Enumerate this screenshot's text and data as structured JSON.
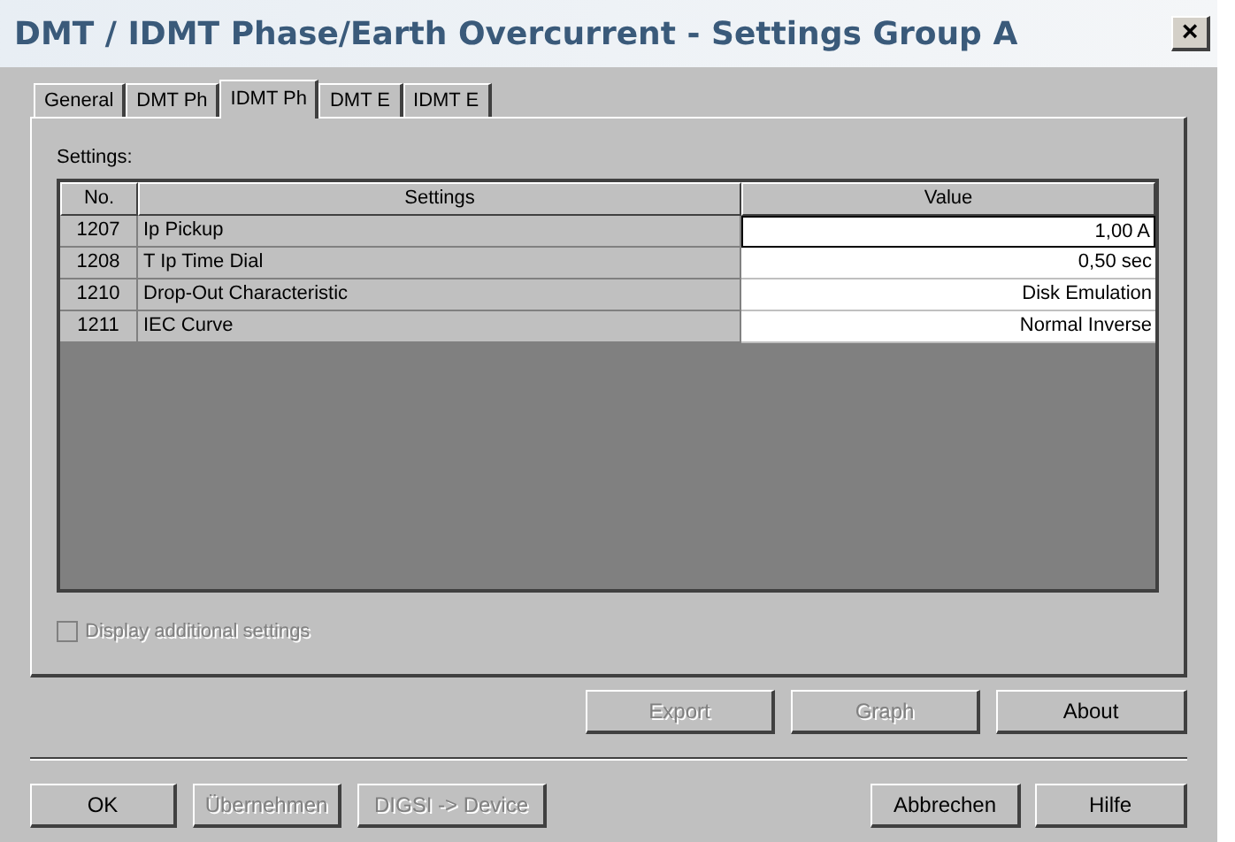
{
  "window": {
    "title": "DMT / IDMT Phase/Earth Overcurrent - Settings Group A",
    "close": "×"
  },
  "tabs": [
    {
      "label": "General",
      "selected": false
    },
    {
      "label": "DMT Ph",
      "selected": false
    },
    {
      "label": "IDMT Ph",
      "selected": true
    },
    {
      "label": "DMT E",
      "selected": false
    },
    {
      "label": "IDMT E",
      "selected": false
    }
  ],
  "settings_label": {
    "text": "Settings:"
  },
  "table": {
    "columns": [
      "No.",
      "Settings",
      "Value"
    ],
    "rows": [
      {
        "no": "1207",
        "setting": "Ip Pickup",
        "value": "1,00 A",
        "selected": true
      },
      {
        "no": "1208",
        "setting": "T Ip Time Dial",
        "value": "0,50 sec",
        "selected": false
      },
      {
        "no": "1210",
        "setting": "Drop-Out Characteristic",
        "value": "Disk Emulation",
        "selected": false
      },
      {
        "no": "1211",
        "setting": "IEC Curve",
        "value": "Normal Inverse",
        "selected": false
      }
    ]
  },
  "display_additional": {
    "label": "Display additional settings",
    "checked": false,
    "disabled": true
  },
  "panel_buttons": [
    {
      "label": "Export",
      "disabled": true
    },
    {
      "label": "Graph",
      "disabled": true
    },
    {
      "label": "About",
      "disabled": false
    }
  ],
  "dialog_buttons_left": [
    {
      "label": "OK",
      "disabled": false
    },
    {
      "label": "Übernehmen",
      "disabled": true
    },
    {
      "label": "DIGSI -> Device",
      "disabled": true
    }
  ],
  "dialog_buttons_right": [
    {
      "label": "Abbrechen",
      "disabled": false
    },
    {
      "label": "Hilfe",
      "disabled": false
    }
  ]
}
